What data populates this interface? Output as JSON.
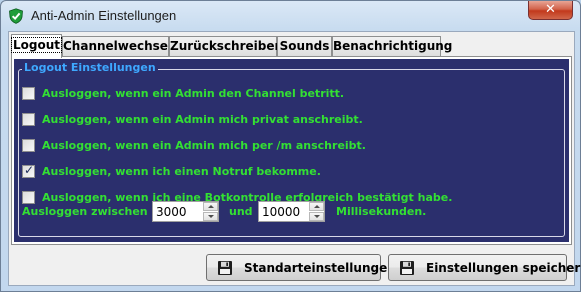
{
  "window": {
    "title": "Anti-Admin Einstellungen",
    "close_glyph": "✕",
    "icon": "shield-check-icon"
  },
  "tabs": [
    {
      "label": "Logout",
      "active": true
    },
    {
      "label": "Channelwechsel",
      "active": false
    },
    {
      "label": "Zurückschreiben",
      "active": false
    },
    {
      "label": "Sounds",
      "active": false
    },
    {
      "label": "Benachrichtigung",
      "active": false
    }
  ],
  "logout": {
    "group_title": "Logout Einstellungen",
    "options": [
      {
        "label": "Ausloggen, wenn ein Admin den Channel betritt.",
        "checked": false
      },
      {
        "label": "Ausloggen, wenn ein Admin mich privat anschreibt.",
        "checked": false
      },
      {
        "label": "Ausloggen, wenn ein Admin mich per /m anschreibt.",
        "checked": false
      },
      {
        "label": "Ausloggen, wenn ich einen Notruf bekomme.",
        "checked": true
      },
      {
        "label": "Ausloggen, wenn ich eine Botkontrolle erfolgreich bestätigt habe.",
        "checked": false
      }
    ],
    "range": {
      "prefix": "Ausloggen zwischen",
      "min_value": "3000",
      "conjunction": "und",
      "max_value": "10000",
      "suffix": "Millisekunden."
    },
    "check_glyph": "✓"
  },
  "buttons": {
    "defaults_label": "Standarteinstellungen",
    "save_label": "Einstellungen speichern",
    "icon": "floppy-disk-icon"
  },
  "colors": {
    "panel_bg": "#2b2f6d",
    "option_text": "#33e033",
    "group_title": "#3ea8ff"
  }
}
